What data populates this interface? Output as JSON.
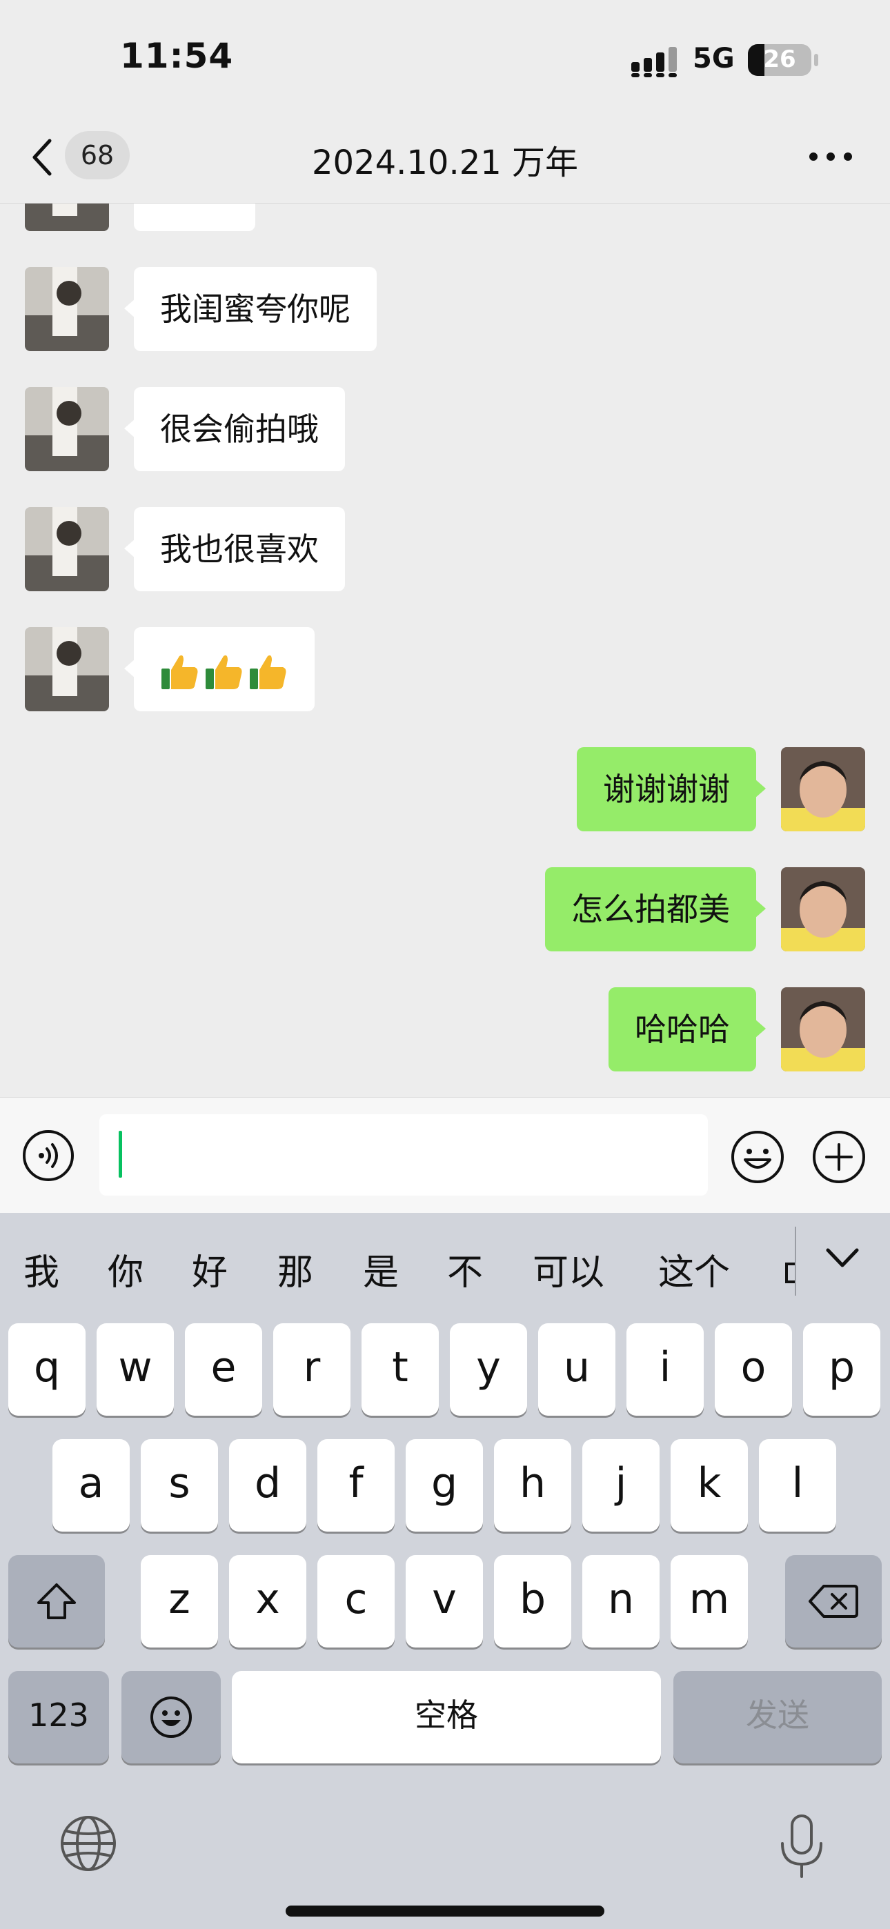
{
  "status_bar": {
    "time": "11:54",
    "network": "5G",
    "battery": "26",
    "battery_level": 0.26
  },
  "nav": {
    "unread_count": "68",
    "title": "2024.10.21 万年"
  },
  "messages": [
    {
      "side": "left",
      "text": ""
    },
    {
      "side": "left",
      "text": "我闺蜜夸你呢"
    },
    {
      "side": "left",
      "text": "很会偷拍哦"
    },
    {
      "side": "left",
      "text": "我也很喜欢"
    },
    {
      "side": "left",
      "emoji": [
        "thumbs-up",
        "thumbs-up",
        "thumbs-up"
      ]
    },
    {
      "side": "right",
      "text": "谢谢谢谢"
    },
    {
      "side": "right",
      "text": "怎么拍都美"
    },
    {
      "side": "right",
      "text": "哈哈哈"
    }
  ],
  "input": {
    "value": "",
    "placeholder": ""
  },
  "keyboard": {
    "candidates": [
      "我",
      "你",
      "好",
      "那",
      "是",
      "不",
      "可以",
      "这个"
    ],
    "row1": [
      "q",
      "w",
      "e",
      "r",
      "t",
      "y",
      "u",
      "i",
      "o",
      "p"
    ],
    "row2": [
      "a",
      "s",
      "d",
      "f",
      "g",
      "h",
      "j",
      "k",
      "l"
    ],
    "row3": [
      "z",
      "x",
      "c",
      "v",
      "b",
      "n",
      "m"
    ],
    "numbers_key": "123",
    "space_key": "空格",
    "send_key": "发送"
  },
  "colors": {
    "accent": "#07c160",
    "self_bubble": "#95ec69",
    "other_bubble": "#ffffff",
    "background": "#ededed"
  }
}
